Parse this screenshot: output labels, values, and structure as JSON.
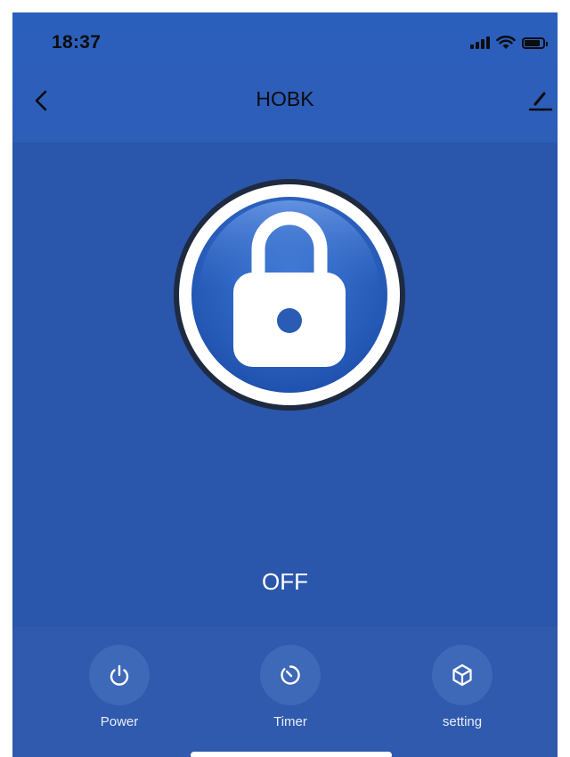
{
  "status_bar": {
    "time": "18:37",
    "icons": [
      "signal-icon",
      "wifi-icon",
      "battery-icon"
    ]
  },
  "header": {
    "title": "HOBK",
    "back_icon": "chevron-left-icon",
    "edit_icon": "pencil-icon"
  },
  "device": {
    "icon": "padlock-icon",
    "state": "OFF"
  },
  "controls": [
    {
      "label": "Power",
      "icon": "power-icon"
    },
    {
      "label": "Timer",
      "icon": "timer-icon"
    },
    {
      "label": "setting",
      "icon": "cube-icon"
    }
  ],
  "colors": {
    "background": "#2a56ab",
    "header": "#2c5eba",
    "control_circle": "#3e69b8",
    "text_light": "#ffffff"
  }
}
